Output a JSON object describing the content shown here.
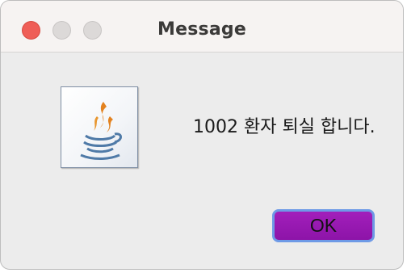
{
  "window": {
    "title": "Message",
    "controls": {
      "close_icon": "close-icon",
      "minimize_icon": "minimize-icon",
      "zoom_icon": "zoom-icon"
    }
  },
  "dialog": {
    "icon": "java-coffee-cup-icon",
    "message": "1002 환자 퇴실 합니다.",
    "ok_label": "OK"
  },
  "colors": {
    "close": "#ef5e57",
    "button": "#9718b2",
    "button_focus_ring": "#6e9ae6",
    "background": "#ececec"
  }
}
